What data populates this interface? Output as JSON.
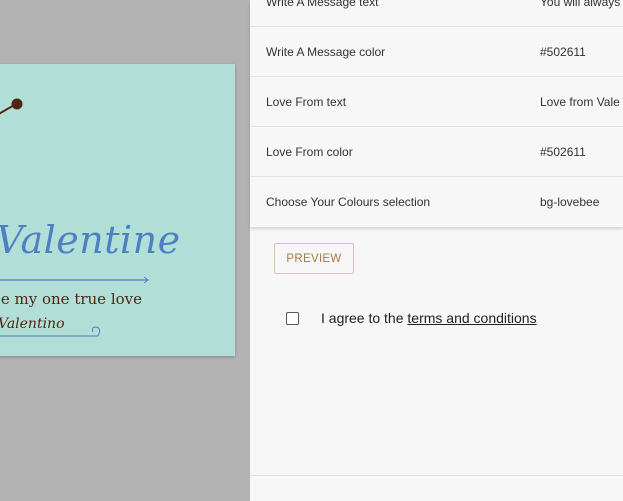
{
  "card": {
    "title": "Valentine",
    "message": "ee my one true love",
    "from": "Valentino"
  },
  "table": {
    "rows": [
      {
        "label": "Write A Message text",
        "value": "You will always"
      },
      {
        "label": "Write A Message color",
        "value": "#502611"
      },
      {
        "label": "Love From text",
        "value": "Love from Vale"
      },
      {
        "label": "Love From color",
        "value": "#502611"
      },
      {
        "label": "Choose Your Colours selection",
        "value": "bg-lovebee"
      }
    ]
  },
  "preview_label": "PREVIEW",
  "agreement": {
    "prefix": "I agree to the ",
    "link": "terms and conditions",
    "checked": false
  },
  "colors": {
    "card_bg": "#b1dfd8",
    "title": "#4e7fc2",
    "text": "#502611",
    "button": "#a37b45"
  }
}
